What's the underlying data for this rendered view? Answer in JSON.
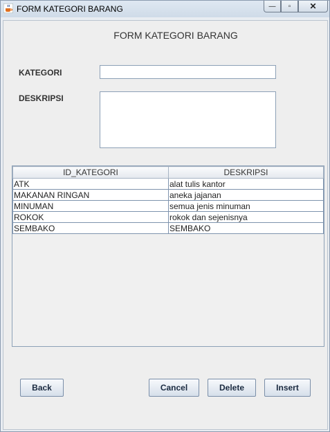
{
  "window": {
    "title": "FORM KATEGORI BARANG",
    "icon": "java-cup-icon"
  },
  "form": {
    "title": "FORM KATEGORI BARANG",
    "kategori_label": "KATEGORI",
    "kategori_value": "",
    "deskripsi_label": "DESKRIPSI",
    "deskripsi_value": ""
  },
  "table": {
    "columns": [
      "ID_KATEGORI",
      "DESKRIPSI"
    ],
    "rows": [
      [
        "ATK",
        "alat tulis kantor"
      ],
      [
        "MAKANAN RINGAN",
        "aneka jajanan"
      ],
      [
        "MINUMAN",
        "semua jenis minuman"
      ],
      [
        "ROKOK",
        "rokok dan sejenisnya"
      ],
      [
        "SEMBAKO",
        "SEMBAKO"
      ]
    ]
  },
  "buttons": {
    "back": "Back",
    "cancel": "Cancel",
    "delete": "Delete",
    "insert": "Insert"
  },
  "colors": {
    "border": "#7e93ad",
    "panel": "#eeeeee"
  }
}
